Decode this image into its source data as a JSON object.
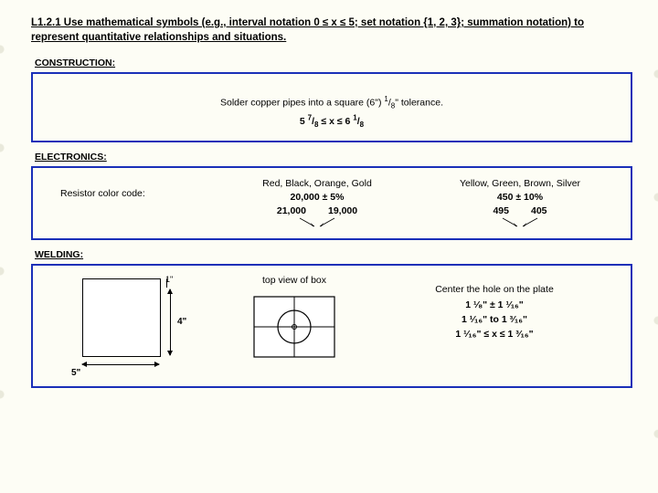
{
  "standard": "L1.2.1 Use mathematical symbols (e.g., interval notation 0 ≤ x ≤ 5; set notation {1, 2, 3}; summation notation) to represent quantitative relationships and situations.",
  "sections": {
    "construction": {
      "label": "CONSTRUCTION:",
      "line1_pre": "Solder copper pipes into a square (6\") ",
      "line1_frac_top": "1",
      "line1_frac_bot": "8",
      "line1_post": "\" tolerance.",
      "ineq_left_whole": "5",
      "ineq_left_top": "7",
      "ineq_left_bot": "8",
      "ineq_mid": " ≤ x ≤ 6 ",
      "ineq_right_top": "1",
      "ineq_right_bot": "8"
    },
    "electronics": {
      "label": "ELECTRONICS:",
      "left_text": "Resistor color code:",
      "col1": {
        "colors": "Red, Black, Orange, Gold",
        "nominal": "20,000 ± 5%",
        "hi": "21,000",
        "lo": "19,000"
      },
      "col2": {
        "colors": "Yellow, Green, Brown, Silver",
        "nominal": "450 ± 10%",
        "hi": "495",
        "lo": "405"
      }
    },
    "welding": {
      "label": "WELDING:",
      "dim1": "1\"",
      "dim4": "4\"",
      "dim5": "5\"",
      "topview": "top view of box",
      "r_line1": "Center the hole on the plate",
      "r_line2": "1 ¹⁄₈\" ± 1 ¹⁄₁₆\"",
      "r_line3": "1 ¹⁄₁₆\" to 1 ³⁄₁₆\"",
      "r_line4": "1 ¹⁄₁₆\" ≤ x ≤ 1 ³⁄₁₆\""
    }
  }
}
